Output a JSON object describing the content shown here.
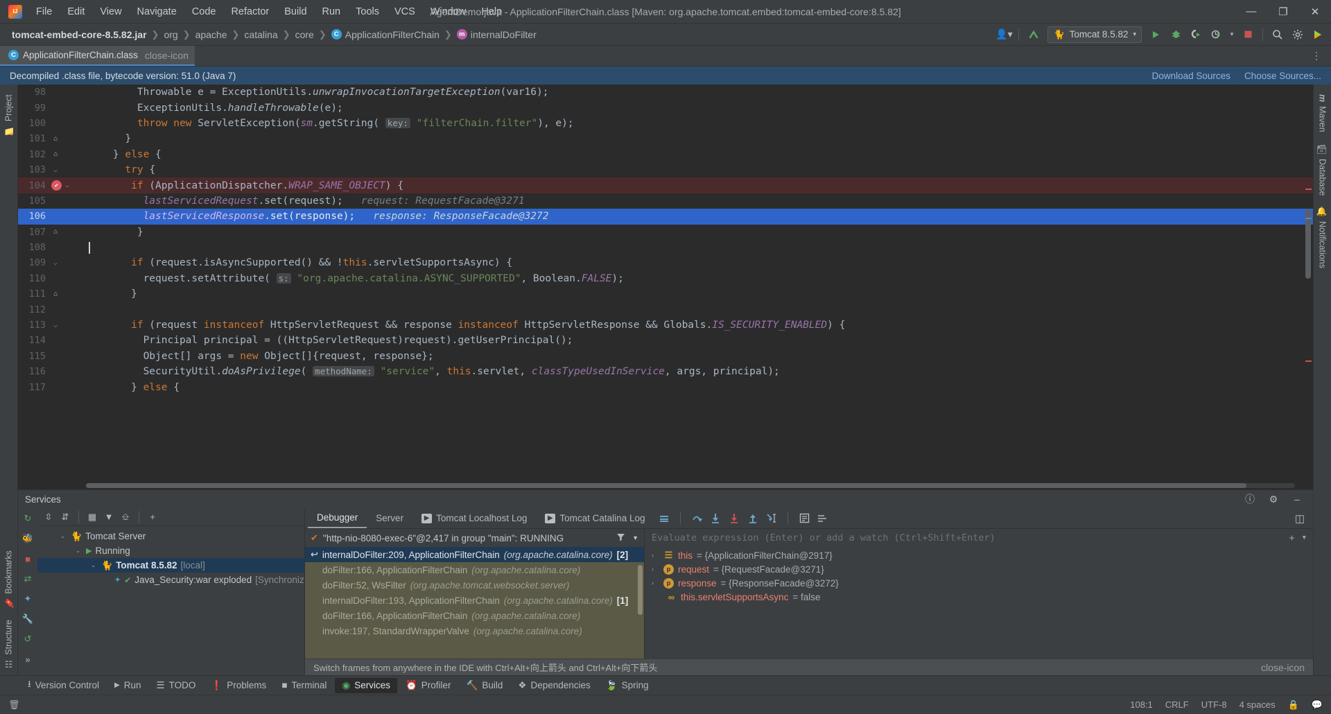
{
  "window": {
    "title": "AgentDemo.java - ApplicationFilterChain.class [Maven: org.apache.tomcat.embed:tomcat-embed-core:8.5.82]",
    "minimize": "—",
    "maximize": "❐",
    "close": "✕",
    "logo": "intellij-idea-logo"
  },
  "menu": [
    {
      "label": "File"
    },
    {
      "label": "Edit"
    },
    {
      "label": "View"
    },
    {
      "label": "Navigate"
    },
    {
      "label": "Code"
    },
    {
      "label": "Refactor"
    },
    {
      "label": "Build"
    },
    {
      "label": "Run"
    },
    {
      "label": "Tools"
    },
    {
      "label": "VCS"
    },
    {
      "label": "Window"
    },
    {
      "label": "Help"
    }
  ],
  "breadcrumb": [
    {
      "label": "tomcat-embed-core-8.5.82.jar",
      "icon": "",
      "bold": true
    },
    {
      "label": "org",
      "icon": ""
    },
    {
      "label": "apache",
      "icon": ""
    },
    {
      "label": "catalina",
      "icon": ""
    },
    {
      "label": "core",
      "icon": ""
    },
    {
      "label": "ApplicationFilterChain",
      "icon": "class-icon"
    },
    {
      "label": "internalDoFilter",
      "icon": "method-icon"
    }
  ],
  "toolbar": {
    "account_icon": "user-account-icon",
    "dropdown_icon": "chevron-down-icon",
    "updates_icon": "updates-arrow-icon",
    "run_config": "Tomcat 8.5.82",
    "run_config_icon": "tomcat-cat-icon",
    "run_icon": "run-play-icon",
    "debug_icon": "debug-bug-icon",
    "coverage_icon": "coverage-icon",
    "profile_icon": "profiler-icon",
    "stop_icon": "stop-square-icon",
    "search_icon": "search-icon",
    "settings_icon": "gear-icon",
    "ide_icon": "ide-feature-icon",
    "more_icon": "more-options-icon"
  },
  "editor_tab": {
    "label": "ApplicationFilterChain.class",
    "icon": "java-class-file-icon",
    "close_icon": "close-icon"
  },
  "notification": {
    "text": "Decompiled .class file, bytecode version: 51.0 (Java 7)",
    "download_sources": "Download Sources",
    "choose_sources": "Choose Sources..."
  },
  "left_strip": [
    {
      "label": "Project",
      "icon": "project-folder-icon"
    },
    {
      "label": "Bookmarks",
      "icon": "bookmarks-icon"
    },
    {
      "label": "Structure",
      "icon": "structure-icon"
    }
  ],
  "right_strip": [
    {
      "label": "Maven",
      "icon": "maven-m-icon"
    },
    {
      "label": "Database",
      "icon": "database-icon"
    },
    {
      "label": "Notifications",
      "icon": "notifications-bell-icon"
    }
  ],
  "code_lines": [
    {
      "num": "98",
      "fold": "",
      "indent": 0,
      "state": "normal"
    },
    {
      "num": "99",
      "fold": "",
      "indent": 0,
      "state": "normal"
    },
    {
      "num": "100",
      "fold": "",
      "indent": 0,
      "state": "normal"
    },
    {
      "num": "101",
      "fold": "⌂",
      "indent": 0,
      "state": "normal"
    },
    {
      "num": "102",
      "fold": "⌂",
      "indent": 0,
      "state": "normal"
    },
    {
      "num": "103",
      "fold": "⌵",
      "indent": 0,
      "state": "normal"
    },
    {
      "num": "104",
      "fold": "⌵",
      "indent": 0,
      "state": "breakpoint"
    },
    {
      "num": "105",
      "fold": "",
      "indent": 0,
      "state": "normal"
    },
    {
      "num": "106",
      "fold": "",
      "indent": 0,
      "state": "current"
    },
    {
      "num": "107",
      "fold": "⌂",
      "indent": 0,
      "state": "normal"
    },
    {
      "num": "108",
      "fold": "",
      "indent": 0,
      "state": "caret"
    },
    {
      "num": "109",
      "fold": "⌵",
      "indent": 0,
      "state": "normal"
    },
    {
      "num": "110",
      "fold": "",
      "indent": 0,
      "state": "normal"
    },
    {
      "num": "111",
      "fold": "⌂",
      "indent": 0,
      "state": "normal"
    },
    {
      "num": "112",
      "fold": "",
      "indent": 0,
      "state": "normal"
    },
    {
      "num": "113",
      "fold": "⌵",
      "indent": 0,
      "state": "normal"
    },
    {
      "num": "114",
      "fold": "",
      "indent": 0,
      "state": "normal"
    },
    {
      "num": "115",
      "fold": "",
      "indent": 0,
      "state": "normal"
    },
    {
      "num": "116",
      "fold": "",
      "indent": 0,
      "state": "normal"
    },
    {
      "num": "117",
      "fold": "",
      "indent": 0,
      "state": "normal"
    }
  ],
  "code_text": {
    "l98": "Throwable e = ExceptionUtils.unwrapInvocationTargetException(var16);",
    "l99": "ExceptionUtils.handleThrowable(e);",
    "l100": "throw new ServletException(sm.getString( key: \"filterChain.filter\"), e);",
    "l101": "}",
    "l102": "} else {",
    "l103": "try {",
    "l104": "if (ApplicationDispatcher.WRAP_SAME_OBJECT) {",
    "l105": "lastServicedRequest.set(request);   request: RequestFacade@3271",
    "l106": "lastServicedResponse.set(response);   response: ResponseFacade@3272",
    "l107": "}",
    "l109": "if (request.isAsyncSupported() && !this.servletSupportsAsync) {",
    "l110": "request.setAttribute( s: \"org.apache.catalina.ASYNC_SUPPORTED\", Boolean.FALSE);",
    "l111": "}",
    "l113": "if (request instanceof HttpServletRequest && response instanceof HttpServletResponse && Globals.IS_SECURITY_ENABLED) {",
    "l114": "Principal principal = ((HttpServletRequest)request).getUserPrincipal();",
    "l115": "Object[] args = new Object[]{request, response};",
    "l116": "SecurityUtil.doAsPrivilege( methodName: \"service\", this.servlet, classTypeUsedInService, args, principal);",
    "l117": "} else {"
  },
  "services": {
    "title": "Services",
    "actions": [
      {
        "icon": "rerun-icon"
      },
      {
        "icon": "debug-icon"
      },
      {
        "icon": "stop-icon"
      },
      {
        "icon": "update-icon"
      },
      {
        "icon": "deploy-icon"
      },
      {
        "icon": "settings-wrench-icon"
      },
      {
        "icon": "rotate-icon"
      },
      {
        "icon": "more-icon"
      }
    ],
    "tree_toolbar": [
      {
        "icon": "expand-all-icon"
      },
      {
        "icon": "collapse-all-icon"
      },
      {
        "icon": "group-icon"
      },
      {
        "icon": "filter-icon"
      },
      {
        "icon": "add-tab-icon"
      },
      {
        "icon": "plus-icon"
      }
    ],
    "tree": [
      {
        "label": "Tomcat Server",
        "icon": "tomcat-cat-icon",
        "depth": 0,
        "chevron": "⌄",
        "selected": false,
        "bold": false,
        "suffix": ""
      },
      {
        "label": "Running",
        "icon": "run-play-icon",
        "depth": 1,
        "chevron": "⌄",
        "selected": false,
        "bold": false,
        "suffix": ""
      },
      {
        "label": "Tomcat 8.5.82",
        "icon": "tomcat-cat-icon",
        "depth": 2,
        "chevron": "⌄",
        "selected": true,
        "bold": true,
        "suffix": "[local]"
      },
      {
        "label": "Java_Security:war exploded",
        "icon": "artifact-icon",
        "depth": 3,
        "chevron": "",
        "selected": false,
        "bold": false,
        "suffix": "[Synchronized]"
      }
    ]
  },
  "debugger": {
    "tabs": [
      {
        "label": "Debugger",
        "active": true,
        "icon": ""
      },
      {
        "label": "Server",
        "active": false,
        "icon": ""
      },
      {
        "label": "Tomcat Localhost Log",
        "active": false,
        "icon": "console-icon"
      },
      {
        "label": "Tomcat Catalina Log",
        "active": false,
        "icon": "console-icon"
      }
    ],
    "step_icons": [
      {
        "icon": "layout-settings-icon"
      },
      {
        "icon": "step-over-icon"
      },
      {
        "icon": "step-into-icon"
      },
      {
        "icon": "force-step-into-icon"
      },
      {
        "icon": "step-out-icon"
      },
      {
        "icon": "run-to-cursor-icon"
      },
      {
        "icon": "evaluate-expression-icon"
      },
      {
        "icon": "frames-view-icon"
      }
    ],
    "thread": "\"http-nio-8080-exec-6\"@2,417 in group \"main\": RUNNING",
    "thread_icon": "thread-running-check-icon",
    "filter_icon": "filter-icon",
    "thread_dropdown_icon": "chevron-down-icon",
    "frames": [
      {
        "method": "internalDoFilter:209, ApplicationFilterChain",
        "pkg": "(org.apache.catalina.core)",
        "count": "[2]",
        "selected": true,
        "icon": "current-frame-icon"
      },
      {
        "method": "doFilter:166, ApplicationFilterChain",
        "pkg": "(org.apache.catalina.core)",
        "count": "",
        "selected": false,
        "icon": ""
      },
      {
        "method": "doFilter:52, WsFilter",
        "pkg": "(org.apache.tomcat.websocket.server)",
        "count": "",
        "selected": false,
        "icon": ""
      },
      {
        "method": "internalDoFilter:193, ApplicationFilterChain",
        "pkg": "(org.apache.catalina.core)",
        "count": "[1]",
        "selected": false,
        "icon": ""
      },
      {
        "method": "doFilter:166, ApplicationFilterChain",
        "pkg": "(org.apache.catalina.core)",
        "count": "",
        "selected": false,
        "icon": ""
      },
      {
        "method": "invoke:197, StandardWrapperValve",
        "pkg": "(org.apache.catalina.core)",
        "count": "",
        "selected": false,
        "icon": ""
      }
    ],
    "evaluate_placeholder": "Evaluate expression (Enter) or add a watch (Ctrl+Shift+Enter)",
    "evaluate_add_icon": "plus-icon",
    "evaluate_dropdown_icon": "chevron-down-icon",
    "variables": [
      {
        "chevron": "›",
        "icon": "field-list-icon",
        "icon_char": "☰",
        "icon_kind": "sq",
        "name": "this",
        "value": "= {ApplicationFilterChain@2917}"
      },
      {
        "chevron": "›",
        "icon": "parameter-icon",
        "icon_char": "p",
        "icon_kind": "round",
        "name": "request",
        "value": "= {RequestFacade@3271}"
      },
      {
        "chevron": "›",
        "icon": "parameter-icon",
        "icon_char": "p",
        "icon_kind": "round",
        "name": "response",
        "value": "= {ResponseFacade@3272}"
      },
      {
        "chevron": "",
        "icon": "boolean-field-icon",
        "icon_char": "∞",
        "icon_kind": "sq",
        "name": "this.servletSupportsAsync",
        "value": "= false"
      }
    ],
    "hint": "Switch frames from anywhere in the IDE with Ctrl+Alt+向上箭头 and Ctrl+Alt+向下箭头",
    "hint_close_icon": "close-icon"
  },
  "tool_windows": [
    {
      "label": "Version Control",
      "icon": "branch-icon",
      "active": false
    },
    {
      "label": "Run",
      "icon": "run-play-icon",
      "active": false
    },
    {
      "label": "TODO",
      "icon": "todo-list-icon",
      "active": false
    },
    {
      "label": "Problems",
      "icon": "problems-icon",
      "active": false
    },
    {
      "label": "Terminal",
      "icon": "terminal-icon",
      "active": false
    },
    {
      "label": "Services",
      "icon": "services-icon",
      "active": true
    },
    {
      "label": "Profiler",
      "icon": "profiler-icon",
      "active": false
    },
    {
      "label": "Build",
      "icon": "build-hammer-icon",
      "active": false
    },
    {
      "label": "Dependencies",
      "icon": "dependencies-icon",
      "active": false
    },
    {
      "label": "Spring",
      "icon": "spring-leaf-icon",
      "active": false
    }
  ],
  "status_bar": {
    "left_icon": "memory-indicator-icon",
    "position": "108:1",
    "line_sep": "CRLF",
    "encoding": "UTF-8",
    "indent": "4 spaces",
    "lock_icon": "read-only-icon",
    "notify_icon": "notification-icon"
  },
  "colors": {
    "accent_blue": "#2f65ca",
    "breakpoint_red": "#db5860",
    "frames_bg": "#5b5a46",
    "notif_bg": "#2d4c6b",
    "editor_bg": "#2b2b2b"
  }
}
